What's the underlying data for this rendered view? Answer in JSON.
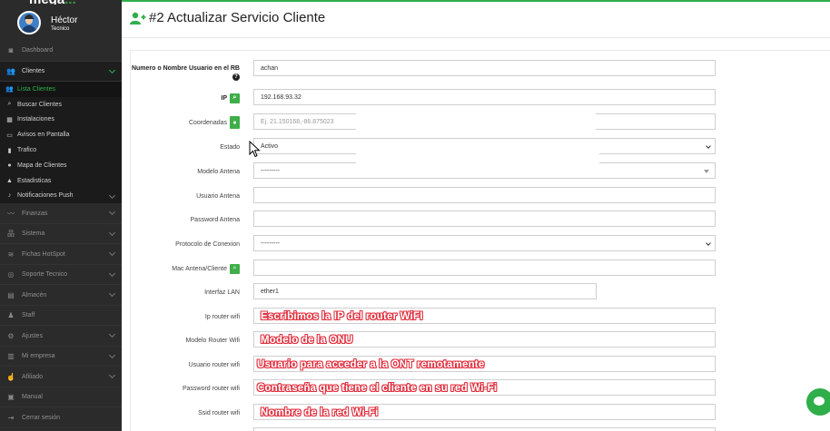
{
  "brand": {
    "name": "mega",
    "suffix": "..."
  },
  "user": {
    "name": "Héctor",
    "role": "Tecnico"
  },
  "sidebar": {
    "items": [
      {
        "label": "Dashboard",
        "icon": "dashboard-icon",
        "glyph": "◙"
      },
      {
        "label": "Clientes",
        "icon": "users-icon",
        "glyph": "👥",
        "active": true,
        "children": [
          {
            "label": "Lista Clientes",
            "icon": "users-icon",
            "glyph": "👥",
            "current": true
          },
          {
            "label": "Buscar Clientes",
            "icon": "search-icon",
            "glyph": "⌕"
          },
          {
            "label": "Instalaciones",
            "icon": "calendar-icon",
            "glyph": "▦"
          },
          {
            "label": "Avisos en Pantalla",
            "icon": "monitor-icon",
            "glyph": "▭"
          },
          {
            "label": "Trafico",
            "icon": "bar-chart-icon",
            "glyph": "▮"
          },
          {
            "label": "Mapa de Clientes",
            "icon": "map-marker-icon",
            "glyph": "●"
          },
          {
            "label": "Estadisticas",
            "icon": "area-chart-icon",
            "glyph": "▲"
          },
          {
            "label": "Notificaciones Push",
            "icon": "bell-icon",
            "glyph": "♪",
            "chevron": true
          }
        ]
      },
      {
        "label": "Finanzas",
        "icon": "line-chart-icon",
        "glyph": "〰"
      },
      {
        "label": "Sistema",
        "icon": "sitemap-icon",
        "glyph": "品"
      },
      {
        "label": "Fichas HotSpot",
        "icon": "wifi-icon",
        "glyph": "≋"
      },
      {
        "label": "Soporte Tecnico",
        "icon": "life-ring-icon",
        "glyph": "◎"
      },
      {
        "label": "Almacén",
        "icon": "warehouse-icon",
        "glyph": "▤"
      },
      {
        "label": "Staff",
        "icon": "staff-icon",
        "glyph": "♟"
      },
      {
        "label": "Ajustes",
        "icon": "cogs-icon",
        "glyph": "⚙"
      },
      {
        "label": "Mi empresa",
        "icon": "building-icon",
        "glyph": "▥"
      },
      {
        "label": "Afiliado",
        "icon": "thumbs-up-icon",
        "glyph": "☝"
      },
      {
        "label": "Manual",
        "icon": "book-icon",
        "glyph": "▣"
      },
      {
        "label": "Cerrar sesión",
        "icon": "sign-out-icon",
        "glyph": "⇥"
      }
    ]
  },
  "header": {
    "title": "#2 Actualizar Servicio Cliente"
  },
  "form": {
    "usuario_rb": {
      "label": "Numero o Nombre Usuario en el RB",
      "value": "achan"
    },
    "ip": {
      "label": "IP",
      "value": "192.168.93.32"
    },
    "coordenadas": {
      "label": "Coordenadas",
      "placeholder": "Ej. 21.150168,-86.875023"
    },
    "estado": {
      "label": "Estado",
      "value": "Activo"
    },
    "modelo_antena": {
      "label": "Modelo Antena",
      "value": "---------"
    },
    "usuario_antena": {
      "label": "Usuario Antena",
      "value": ""
    },
    "password_antena": {
      "label": "Password Antena",
      "value": ""
    },
    "protocolo": {
      "label": "Protocolo de Conexion",
      "value": "---------"
    },
    "mac_antena": {
      "label": "Mac Antena/Cliente",
      "value": ""
    },
    "interfaz_lan": {
      "label": "Interfaz LAN",
      "value": "ether1"
    },
    "ip_router_wifi": {
      "label": "Ip router wifi",
      "annotation": "Escribimos la IP del router WiFI"
    },
    "modelo_router_wifi": {
      "label": "Modelo Router Wifi",
      "annotation": "Modelo de la ONU"
    },
    "usuario_router_wifi": {
      "label": "Usuario router wifi",
      "annotation": "Usuario para acceder a la ONT remotamente"
    },
    "password_router_wifi": {
      "label": "Password router wifi",
      "annotation": "Contraseña que tiene el cliente en su red Wi-Fi"
    },
    "ssid_router_wifi": {
      "label": "Ssid router wifi",
      "annotation": "Nombre de la red Wi-Fi"
    }
  },
  "colors": {
    "accent": "#2fae4a",
    "sidebar_bg": "#2b2b2b",
    "annotation_outline": "#e0303f"
  }
}
